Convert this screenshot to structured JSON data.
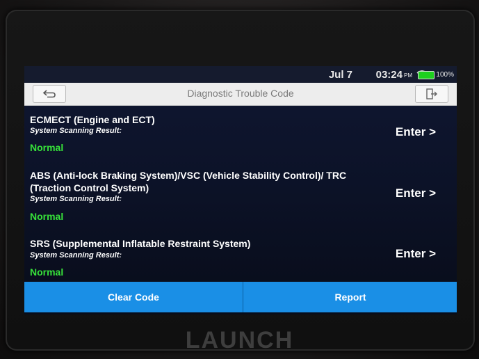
{
  "status_bar": {
    "date": "Jul 7",
    "time": "03:24",
    "ampm": "PM",
    "battery": "100%",
    "battery_color": "#1ed01e"
  },
  "titlebar": {
    "title": "Diagnostic Trouble Code",
    "back_icon": "back-arrow-icon",
    "exit_icon": "exit-icon"
  },
  "systems": [
    {
      "name": "ECMECT (Engine and ECT)",
      "subtitle": "System Scanning Result:",
      "status": "Normal",
      "action": "Enter >"
    },
    {
      "name": "ABS (Anti-lock Braking System)/VSC (Vehicle Stability Control)/ TRC (Traction Control System)",
      "subtitle": "System Scanning Result:",
      "status": "Normal",
      "action": "Enter >"
    },
    {
      "name": "SRS (Supplemental Inflatable Restraint System)",
      "subtitle": "System Scanning Result:",
      "status": "Normal",
      "action": "Enter >"
    }
  ],
  "bottom_bar": {
    "clear_code": "Clear Code",
    "report": "Report",
    "color": "#1a8fe6"
  },
  "brand": "LAUNCH",
  "status_color": "#37e23a"
}
